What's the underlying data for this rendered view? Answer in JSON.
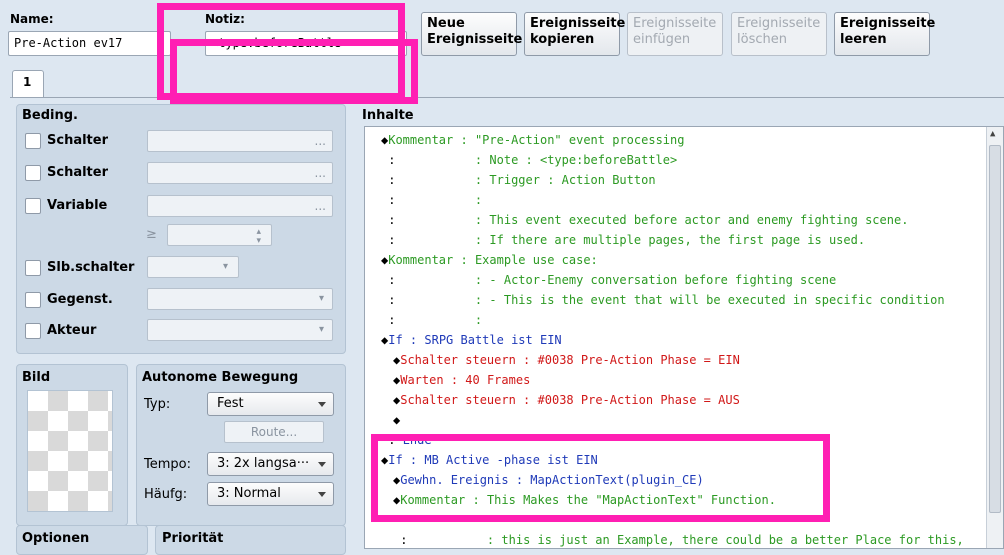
{
  "header": {
    "name_label": "Name:",
    "name_value": "Pre-Action ev17",
    "note_label": "Notiz:",
    "note_value": "<type:beforeBattle>",
    "buttons": [
      {
        "label1": "Neue",
        "label2": "Ereignisseite",
        "enabled": true
      },
      {
        "label1": "Ereignisseite",
        "label2": "kopieren",
        "enabled": true
      },
      {
        "label1": "Ereignisseite",
        "label2": "einfügen",
        "enabled": false
      },
      {
        "label1": "Ereignisseite",
        "label2": "löschen",
        "enabled": false
      },
      {
        "label1": "Ereignisseite",
        "label2": "leeren",
        "enabled": true
      }
    ]
  },
  "tabs": [
    "1"
  ],
  "conditions": {
    "title": "Beding.",
    "switch1": "Schalter",
    "switch2": "Schalter",
    "variable": "Variable",
    "self_switch": "Slb.schalter",
    "item": "Gegenst.",
    "actor": "Akteur",
    "ellipsis": "...",
    "gte": "≥"
  },
  "image": {
    "title": "Bild"
  },
  "autonomous": {
    "title": "Autonome Bewegung",
    "type_label": "Typ:",
    "type_value": "Fest",
    "route_label": "Route...",
    "speed_label": "Tempo:",
    "speed_value": "3: 2x langsa···",
    "freq_label": "Häufg:",
    "freq_value": "3: Normal"
  },
  "options": {
    "title": "Optionen"
  },
  "priority": {
    "title": "Priorität"
  },
  "contents": {
    "title": "Inhalte",
    "lines": [
      {
        "marker": "◆",
        "head": "Kommentar",
        "sep": " : ",
        "text": "\"Pre-Action\" event processing",
        "color": "g",
        "indent": 0
      },
      {
        "marker": " : ",
        "head": "",
        "sep": "          : ",
        "text": "Note : <type:beforeBattle>",
        "color": "g",
        "indent": 0
      },
      {
        "marker": " : ",
        "head": "",
        "sep": "          : ",
        "text": "Trigger : Action Button",
        "color": "g",
        "indent": 0
      },
      {
        "marker": " : ",
        "head": "",
        "sep": "          : ",
        "text": "",
        "color": "g",
        "indent": 0
      },
      {
        "marker": " : ",
        "head": "",
        "sep": "          : ",
        "text": "This event executed before actor and enemy fighting scene.",
        "color": "g",
        "indent": 0
      },
      {
        "marker": " : ",
        "head": "",
        "sep": "          : ",
        "text": "If there are multiple pages, the first page is used.",
        "color": "g",
        "indent": 0
      },
      {
        "marker": "◆",
        "head": "Kommentar",
        "sep": " : ",
        "text": "Example use case:",
        "color": "g",
        "indent": 0
      },
      {
        "marker": " : ",
        "head": "",
        "sep": "          : ",
        "text": "- Actor-Enemy conversation before fighting scene",
        "color": "g",
        "indent": 0
      },
      {
        "marker": " : ",
        "head": "",
        "sep": "          : ",
        "text": "- This is the event that will be executed in specific condition",
        "color": "g",
        "indent": 0
      },
      {
        "marker": " : ",
        "head": "",
        "sep": "          : ",
        "text": "",
        "color": "g",
        "indent": 0
      },
      {
        "marker": "◆",
        "head": "If",
        "sep": " : ",
        "text": "SRPG Battle ist EIN",
        "color": "b",
        "indent": 0
      },
      {
        "marker": "◆",
        "head": "Schalter steuern",
        "sep": " : ",
        "text": "#0038 Pre-Action Phase = EIN",
        "color": "r",
        "indent": 1
      },
      {
        "marker": "◆",
        "head": "Warten",
        "sep": " : ",
        "text": "40 Frames",
        "color": "r",
        "indent": 1
      },
      {
        "marker": "◆",
        "head": "Schalter steuern",
        "sep": " : ",
        "text": "#0038 Pre-Action Phase = AUS",
        "color": "r",
        "indent": 1
      },
      {
        "marker": "◆",
        "head": "",
        "sep": "",
        "text": "",
        "color": "k",
        "indent": 1
      },
      {
        "marker": " : ",
        "head": "Ende",
        "sep": "",
        "text": "",
        "color": "b",
        "indent": 0
      },
      {
        "marker": "◆",
        "head": "If",
        "sep": " : ",
        "text": "MB Active -phase ist EIN",
        "color": "b",
        "indent": 0
      },
      {
        "marker": "◆",
        "head": "Gewhn. Ereignis",
        "sep": " : ",
        "text": "MapActionText(plugin_CE)",
        "color": "b",
        "indent": 1
      },
      {
        "marker": "◆",
        "head": "Kommentar",
        "sep": " : ",
        "text": "This Makes the \"MapActionText\" Function.",
        "color": "g",
        "indent": 1
      },
      {
        "marker": "",
        "head": "",
        "sep": "",
        "text": "",
        "color": "k",
        "indent": 1
      },
      {
        "marker": " : ",
        "head": "",
        "sep": "          : ",
        "text": "this is just an Example, there could be a better Place for this,",
        "color": "g",
        "indent": 1
      }
    ]
  }
}
